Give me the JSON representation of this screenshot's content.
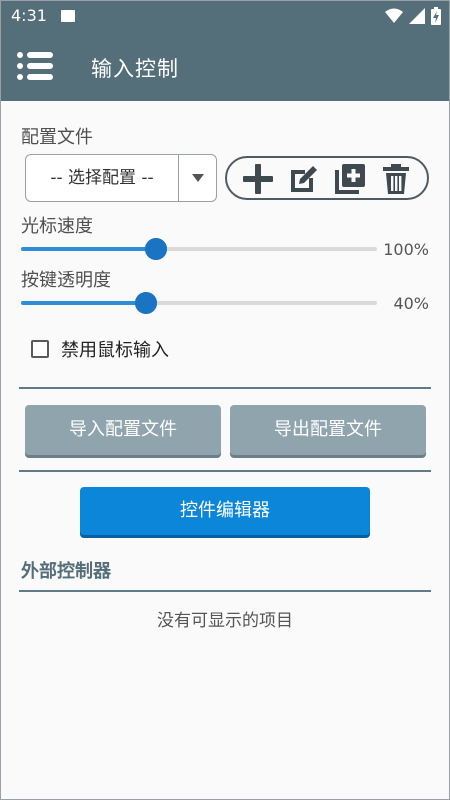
{
  "status_bar": {
    "time": "4:31",
    "icons": [
      "image-notification-icon",
      "wifi-icon",
      "signal-icon",
      "battery-charging-icon"
    ]
  },
  "app_bar": {
    "title": "输入控制",
    "menu_icon": "menu-icon"
  },
  "profile": {
    "label": "配置文件",
    "selected": "-- 选择配置 --",
    "actions": [
      "add-icon",
      "edit-icon",
      "duplicate-icon",
      "delete-icon"
    ]
  },
  "cursor_speed": {
    "label": "光标速度",
    "value_text": "100%",
    "fraction": 0.38
  },
  "button_opacity": {
    "label": "按键透明度",
    "value_text": "40%",
    "fraction": 0.35
  },
  "disable_mouse": {
    "label": "禁用鼠标输入",
    "checked": false
  },
  "buttons": {
    "import": "导入配置文件",
    "export": "导出配置文件",
    "editor": "控件编辑器"
  },
  "external_controllers": {
    "header": "外部控制器",
    "empty": "没有可显示的项目"
  },
  "colors": {
    "primary": "#546e7a",
    "accent": "#0b86d8",
    "slider": "#1b74c3",
    "gray_button": "#90a4ae"
  }
}
